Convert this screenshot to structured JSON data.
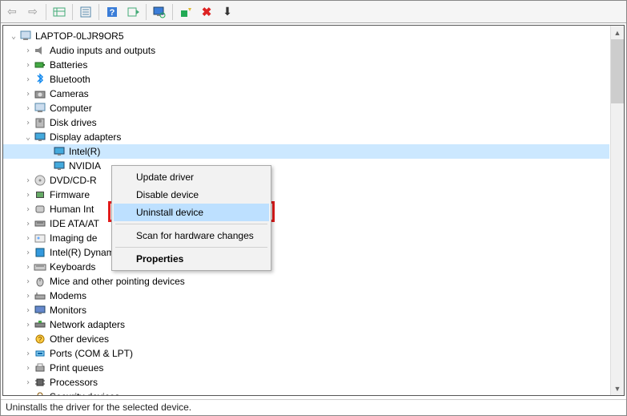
{
  "toolbar": {
    "back": "⇦",
    "fwd": "⇨",
    "close_x": "✖",
    "down": "⬇"
  },
  "root": {
    "name": "LAPTOP-0LJR9OR5"
  },
  "categories": [
    {
      "label": "Audio inputs and outputs",
      "icon": "speaker",
      "expand": "closed"
    },
    {
      "label": "Batteries",
      "icon": "battery",
      "expand": "closed"
    },
    {
      "label": "Bluetooth",
      "icon": "bluetooth",
      "expand": "closed"
    },
    {
      "label": "Cameras",
      "icon": "camera",
      "expand": "closed"
    },
    {
      "label": "Computer",
      "icon": "computer",
      "expand": "closed"
    },
    {
      "label": "Disk drives",
      "icon": "disk",
      "expand": "closed"
    },
    {
      "label": "Display adapters",
      "icon": "display",
      "expand": "open"
    },
    {
      "label": "DVD/CD-R",
      "icon": "dvd",
      "expand": "closed",
      "truncated": true
    },
    {
      "label": "Firmware",
      "icon": "firmware",
      "expand": "closed"
    },
    {
      "label": "Human Int",
      "icon": "hid",
      "expand": "closed",
      "truncated": true
    },
    {
      "label": "IDE ATA/AT",
      "icon": "ide",
      "expand": "closed",
      "truncated": true
    },
    {
      "label": "Imaging de",
      "icon": "imaging",
      "expand": "closed",
      "truncated": true
    },
    {
      "label": "Intel(R) Dynamic Platform and Thermal Framework",
      "icon": "intel",
      "expand": "closed"
    },
    {
      "label": "Keyboards",
      "icon": "keyboard",
      "expand": "closed"
    },
    {
      "label": "Mice and other pointing devices",
      "icon": "mouse",
      "expand": "closed"
    },
    {
      "label": "Modems",
      "icon": "modem",
      "expand": "closed"
    },
    {
      "label": "Monitors",
      "icon": "monitor",
      "expand": "closed"
    },
    {
      "label": "Network adapters",
      "icon": "network",
      "expand": "closed"
    },
    {
      "label": "Other devices",
      "icon": "other",
      "expand": "closed"
    },
    {
      "label": "Ports (COM & LPT)",
      "icon": "port",
      "expand": "closed"
    },
    {
      "label": "Print queues",
      "icon": "printer",
      "expand": "closed"
    },
    {
      "label": "Processors",
      "icon": "cpu",
      "expand": "closed"
    },
    {
      "label": "Security devices",
      "icon": "security",
      "expand": "closed",
      "partial": true
    }
  ],
  "display_children": [
    {
      "label": "Intel(R)",
      "selected": true
    },
    {
      "label": "NVIDIA"
    }
  ],
  "context_menu": {
    "items": [
      {
        "label": "Update driver"
      },
      {
        "label": "Disable device"
      },
      {
        "label": "Uninstall device",
        "highlight": true,
        "redbox": true
      },
      {
        "sep": true
      },
      {
        "label": "Scan for hardware changes"
      },
      {
        "sep": true
      },
      {
        "label": "Properties",
        "bold": true
      }
    ]
  },
  "status": "Uninstalls the driver for the selected device."
}
